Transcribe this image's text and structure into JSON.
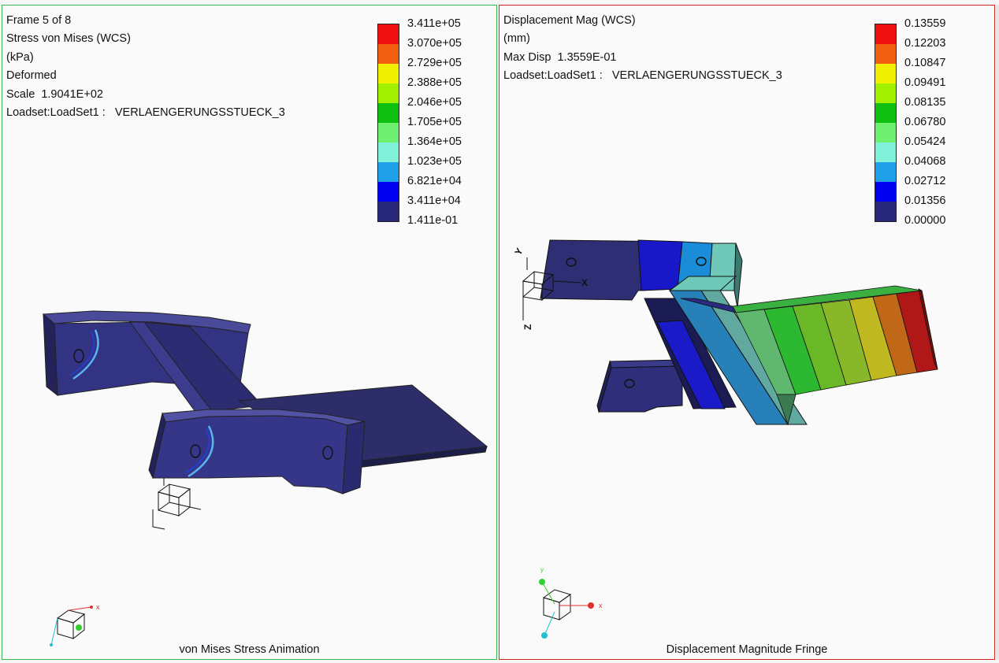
{
  "left_panel": {
    "info_lines": [
      "Frame 5 of 8",
      "Stress von Mises (WCS)",
      "(kPa)",
      "Deformed",
      "Scale  1.9041E+02",
      "Loadset:LoadSet1 :   VERLAENGERUNGSSTUECK_3"
    ],
    "legend_values": [
      "3.411e+05",
      "3.070e+05",
      "2.729e+05",
      "2.388e+05",
      "2.046e+05",
      "1.705e+05",
      "1.364e+05",
      "1.023e+05",
      "6.821e+04",
      "3.411e+04",
      "1.411e-01"
    ],
    "caption": "von Mises Stress Animation",
    "triad_label": "x"
  },
  "right_panel": {
    "info_lines": [
      "Displacement Mag (WCS)",
      "(mm)",
      "Max Disp  1.3559E-01",
      "Loadset:LoadSet1 :   VERLAENGERUNGSSTUECK_3"
    ],
    "legend_values": [
      "0.13559",
      "0.12203",
      "0.10847",
      "0.09491",
      "0.08135",
      "0.06780",
      "0.05424",
      "0.04068",
      "0.02712",
      "0.01356",
      "0.00000"
    ],
    "caption": "Displacement Magnitude Fringe",
    "csys_labels": {
      "y": "Y",
      "x": "X",
      "z": "Z"
    },
    "triad_labels": {
      "y": "y",
      "x": "x"
    }
  },
  "legend_colors": [
    "#f01010",
    "#f06010",
    "#f0f000",
    "#a0f000",
    "#10c010",
    "#70f070",
    "#80f0d8",
    "#20a0e8",
    "#0000f0",
    "#28287c"
  ]
}
